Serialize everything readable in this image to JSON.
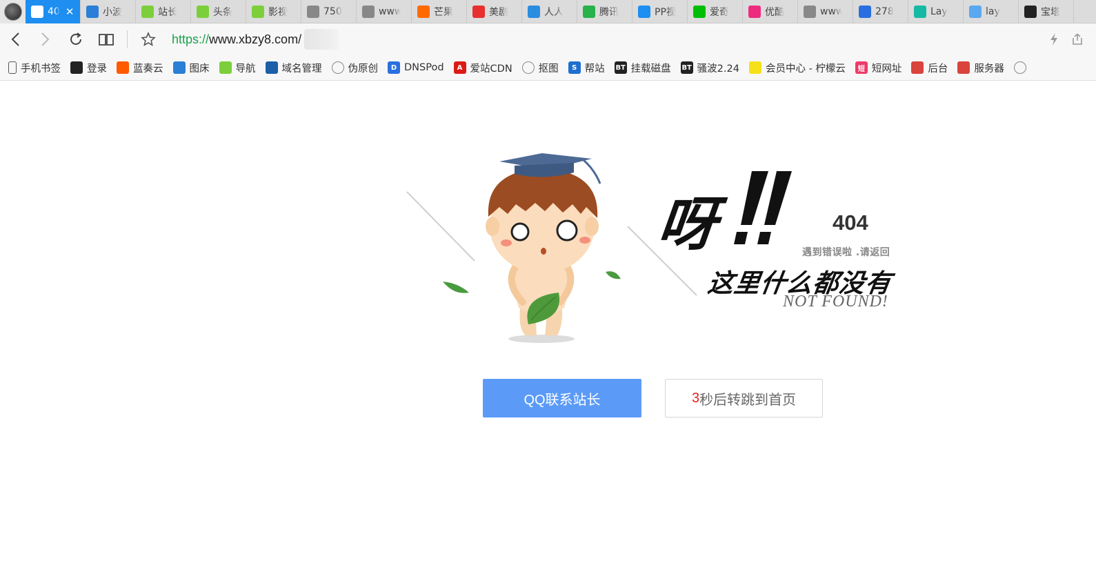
{
  "tabs": [
    {
      "label": "40",
      "icon": "qq-penguin-icon",
      "color": "#1e8ef0",
      "active": true
    },
    {
      "label": "小波",
      "icon": "image-icon",
      "color": "#2b7fd6"
    },
    {
      "label": "站长",
      "icon": "diamond-icon",
      "color": "#7ccf3a"
    },
    {
      "label": "头条",
      "icon": "diamond-icon",
      "color": "#7ccf3a"
    },
    {
      "label": "影视",
      "icon": "diamond-icon",
      "color": "#7ccf3a"
    },
    {
      "label": "750",
      "icon": "globe-icon",
      "color": "#888888"
    },
    {
      "label": "www",
      "icon": "globe-icon",
      "color": "#888888"
    },
    {
      "label": "芒果",
      "icon": "mango-icon",
      "color": "#ff6a00"
    },
    {
      "label": "美剧",
      "icon": "pang-icon",
      "color": "#e83030"
    },
    {
      "label": "人人",
      "icon": "rr-icon",
      "color": "#2a8de0"
    },
    {
      "label": "腾讯",
      "icon": "play-icon",
      "color": "#27b24a"
    },
    {
      "label": "PP视",
      "icon": "pp-icon",
      "color": "#1e8ef0"
    },
    {
      "label": "爱奇",
      "icon": "iqiyi-icon",
      "color": "#00be06"
    },
    {
      "label": "优酷",
      "icon": "youku-icon",
      "color": "#ee2c7f"
    },
    {
      "label": "www",
      "icon": "globe-icon",
      "color": "#888888"
    },
    {
      "label": "278",
      "icon": "paw-icon",
      "color": "#2a6fe0"
    },
    {
      "label": "Lay",
      "icon": "layui-icon",
      "color": "#16b9a3"
    },
    {
      "label": "lay",
      "icon": "layer-icon",
      "color": "#5aa8f0"
    },
    {
      "label": "宝塔",
      "icon": "bt-icon",
      "color": "#222222"
    }
  ],
  "toolbar": {
    "url_scheme": "https://",
    "url_host": "www.xbzy8.com/"
  },
  "bookmarks": [
    {
      "label": "手机书签",
      "icon": "phone-icon",
      "color": "#555555",
      "glyph": ""
    },
    {
      "label": "登录",
      "icon": "qq-penguin-icon",
      "color": "#222222",
      "glyph": ""
    },
    {
      "label": "蓝奏云",
      "icon": "lanzou-icon",
      "color": "#ff5a00",
      "glyph": ""
    },
    {
      "label": "图床",
      "icon": "image-icon",
      "color": "#2b7fd6",
      "glyph": ""
    },
    {
      "label": "导航",
      "icon": "diamond-icon",
      "color": "#7ccf3a",
      "glyph": ""
    },
    {
      "label": "域名管理",
      "icon": "wave-icon",
      "color": "#1b5fa8",
      "glyph": ""
    },
    {
      "label": "伪原创",
      "icon": "globe-icon",
      "color": "#888888",
      "glyph": ""
    },
    {
      "label": "DNSPod",
      "icon": "dnspod-icon",
      "color": "#2a6fe0",
      "glyph": "D"
    },
    {
      "label": "爱站CDN",
      "icon": "angular-icon",
      "color": "#dd1b16",
      "glyph": "A"
    },
    {
      "label": "抠图",
      "icon": "globe-icon",
      "color": "#888888",
      "glyph": ""
    },
    {
      "label": "帮站",
      "icon": "s-icon",
      "color": "#1e6fd0",
      "glyph": "S"
    },
    {
      "label": "挂载磁盘",
      "icon": "bt-icon",
      "color": "#222222",
      "glyph": "BT"
    },
    {
      "label": "骚波2.24",
      "icon": "bt-icon",
      "color": "#222222",
      "glyph": "BT"
    },
    {
      "label": "会员中心 - 柠檬云",
      "icon": "lemon-icon",
      "color": "#f5e11a",
      "glyph": ""
    },
    {
      "label": "短网址",
      "icon": "short-url-icon",
      "color": "#ee3a6a",
      "glyph": "短"
    },
    {
      "label": "后台",
      "icon": "shell-icon",
      "color": "#d9443c",
      "glyph": ""
    },
    {
      "label": "服务器",
      "icon": "shell-icon",
      "color": "#d9443c",
      "glyph": ""
    },
    {
      "label": "",
      "icon": "globe-icon",
      "color": "#888888",
      "glyph": ""
    }
  ],
  "error": {
    "exclaim": "呀",
    "code": "404",
    "hint": "遇到错误啦 .请返回",
    "headline": "这里什么都没有",
    "subline": "NOT FOUND!"
  },
  "buttons": {
    "qq_label": "QQ联系站长",
    "countdown": "3",
    "redirect_label": "秒后转跳到首页"
  },
  "colors": {
    "accent": "#5b9bf7",
    "countdown": "#e0211b",
    "active_tab": "#1e8ef0"
  }
}
